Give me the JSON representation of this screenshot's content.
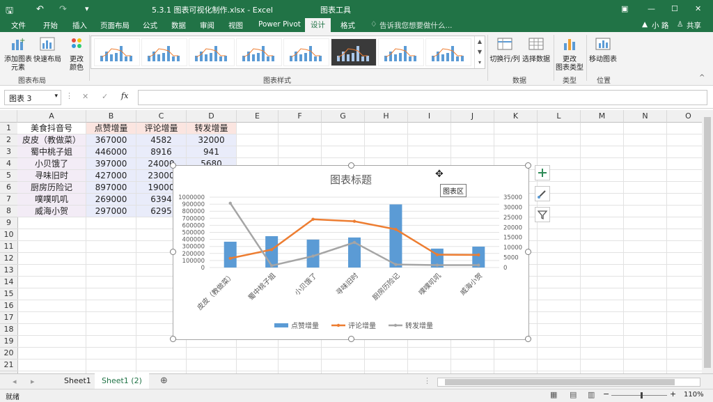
{
  "window": {
    "title": "5.3.1 图表可视化制作.xlsx - Excel",
    "context_tab": "图表工具",
    "user": "小 路",
    "share": "共享"
  },
  "ribbon_tabs": [
    "文件",
    "开始",
    "插入",
    "页面布局",
    "公式",
    "数据",
    "审阅",
    "视图",
    "Power Pivot",
    "设计",
    "格式"
  ],
  "active_tab": "设计",
  "tell_me": "告诉我您想要做什么...",
  "ribbon": {
    "add_element": "添加图表\n元素",
    "quick_layout": "快速布局",
    "change_color": "更改\n颜色",
    "group_layout": "图表布局",
    "group_styles": "图表样式",
    "switch_row_col": "切换行/列",
    "select_data": "选择数据",
    "group_data": "数据",
    "change_type": "更改\n图表类型",
    "group_type": "类型",
    "move_chart": "移动图表",
    "group_location": "位置"
  },
  "formula_bar": {
    "name_box": "图表 3",
    "fx": "fx",
    "cancel": "✕",
    "enter": "✓",
    "value": ""
  },
  "columns": [
    "A",
    "B",
    "C",
    "D",
    "E",
    "F",
    "G",
    "H",
    "I",
    "J",
    "K",
    "L",
    "M",
    "N",
    "O"
  ],
  "rows": [
    "1",
    "2",
    "3",
    "4",
    "5",
    "6",
    "7",
    "8",
    "9",
    "10",
    "11",
    "12",
    "13",
    "14",
    "15",
    "16",
    "17",
    "18",
    "19",
    "20",
    "21",
    "22"
  ],
  "table": {
    "headers": [
      "美食抖音号",
      "点赞增量",
      "评论增量",
      "转发增量"
    ],
    "rows": [
      [
        "皮皮（教做菜）",
        "367000",
        "4582",
        "32000"
      ],
      [
        "蜀中桃子姐",
        "446000",
        "8916",
        "941"
      ],
      [
        "小贝饿了",
        "397000",
        "24000",
        "5680"
      ],
      [
        "寻味旧时",
        "427000",
        "23000",
        ""
      ],
      [
        "厨房历险记",
        "897000",
        "19000",
        ""
      ],
      [
        "噗噗叽叽",
        "269000",
        "6394",
        ""
      ],
      [
        "威海小贺",
        "297000",
        "6295",
        ""
      ]
    ]
  },
  "chart_data": {
    "type": "bar",
    "title": "图表标题",
    "categories": [
      "皮皮（教做菜）",
      "蜀中桃子姐",
      "小贝饿了",
      "寻味旧时",
      "厨房历险记",
      "噗噗叽叽",
      "威海小贺"
    ],
    "series": [
      {
        "name": "点赞增量",
        "type": "bar",
        "axis": "left",
        "color": "#5b9bd5",
        "values": [
          367000,
          446000,
          397000,
          427000,
          897000,
          269000,
          297000
        ]
      },
      {
        "name": "评论增量",
        "type": "line",
        "axis": "right",
        "color": "#ed7d31",
        "values": [
          4582,
          8916,
          24000,
          23000,
          19000,
          6394,
          6295
        ]
      },
      {
        "name": "转发增量",
        "type": "line",
        "axis": "right",
        "color": "#a5a5a5",
        "values": [
          32000,
          941,
          5680,
          12500,
          1500,
          1200,
          1200
        ]
      }
    ],
    "y_left": {
      "min": 0,
      "max": 1000000,
      "ticks": [
        "0",
        "100000",
        "200000",
        "300000",
        "400000",
        "500000",
        "600000",
        "700000",
        "800000",
        "900000",
        "1000000"
      ]
    },
    "y_right": {
      "min": 0,
      "max": 35000,
      "ticks": [
        "0",
        "5000",
        "10000",
        "15000",
        "20000",
        "25000",
        "30000",
        "35000"
      ]
    },
    "legend_position": "bottom",
    "grid": true
  },
  "tooltip": "图表区",
  "sheets": [
    "Sheet1",
    "Sheet1 (2)"
  ],
  "active_sheet": "Sheet1 (2)",
  "status": "就绪",
  "zoom": "110%"
}
